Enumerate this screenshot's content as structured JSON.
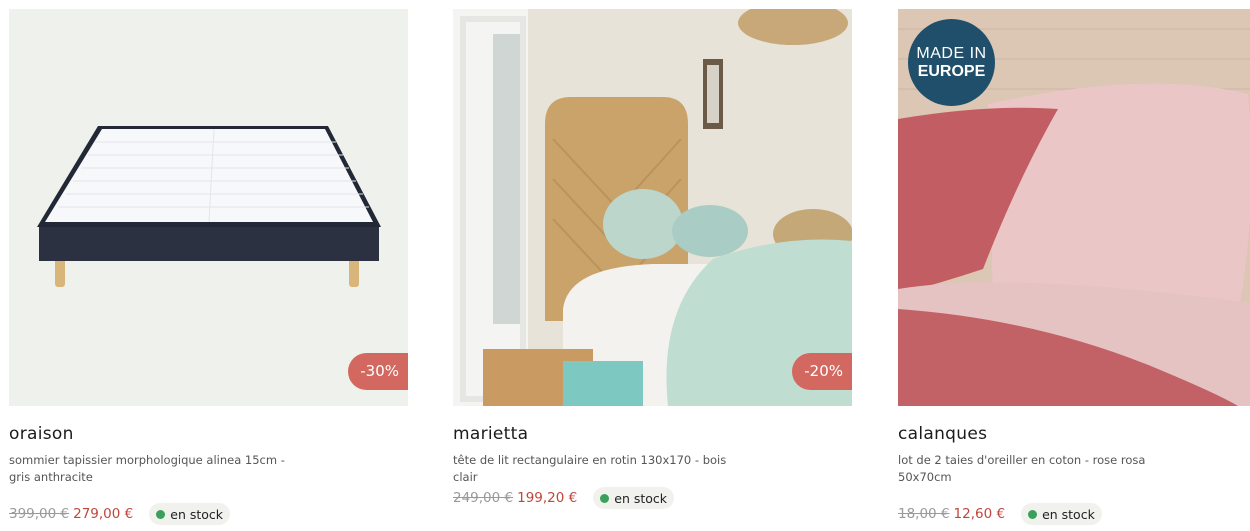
{
  "products": [
    {
      "name": "oraison",
      "description": "sommier tapissier morphologique alinea 15cm - gris anthracite",
      "old_price": "399,00 €",
      "new_price": "279,00 €",
      "discount": "-30%",
      "stock": "en stock"
    },
    {
      "name": "marietta",
      "description": "tête de lit rectangulaire en rotin 130x170 - bois clair",
      "old_price": "249,00 €",
      "new_price": "199,20 €",
      "discount": "-20%",
      "stock": "en stock"
    },
    {
      "name": "calanques",
      "description": "lot de 2 taies d'oreiller en coton - rose rosa 50x70cm",
      "old_price": "18,00 €",
      "new_price": "12,60 €",
      "badge_line1": "MADE IN",
      "badge_line2": "EUROPE",
      "stock": "en stock"
    }
  ],
  "colors": {
    "discount_bg": "#d2685f",
    "sale_price": "#c2453b",
    "stock_dot": "#3aa05a",
    "badge_bg": "#1f4f6a"
  }
}
